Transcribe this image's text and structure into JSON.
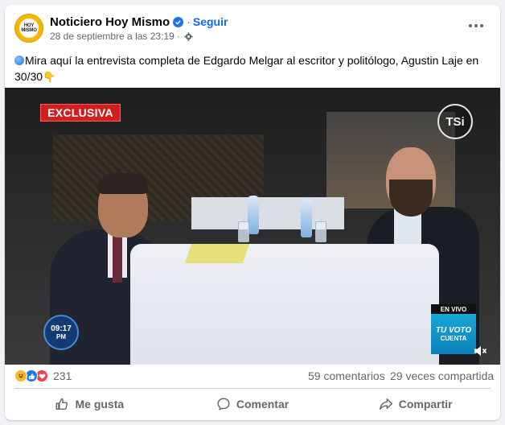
{
  "post": {
    "page_name": "Noticiero Hoy Mismo",
    "follow_label": "Seguir",
    "separator": "·",
    "timestamp": "28 de septiembre a las 23:19",
    "avatar_logo": {
      "line1": "HOY",
      "line2": "MISMO"
    },
    "caption": "Mira aquí la entrevista completa de Edgardo Melgar al escritor y politólogo, Agustin Laje en 30/30"
  },
  "video": {
    "badge_exclusive": "EXCLUSIVA",
    "channel_logo": "TSi",
    "clock_time": "09:17",
    "clock_ampm": "PM",
    "live_label": "EN VIVO",
    "vote_line1": "TU VOTO",
    "vote_line2": "CUENTA"
  },
  "stats": {
    "reaction_icons": [
      "haha-icon",
      "like-icon",
      "love-icon"
    ],
    "reactions_count": "231",
    "comments": "59 comentarios",
    "shares": "29 veces compartida"
  },
  "actions": {
    "like_label": "Me gusta",
    "comment_label": "Comentar",
    "share_label": "Compartir"
  },
  "colors": {
    "accent_blue": "#0866ff",
    "verified": "#1877f2",
    "muted_text": "#65676b",
    "exclusive_red": "#d11f1f"
  }
}
